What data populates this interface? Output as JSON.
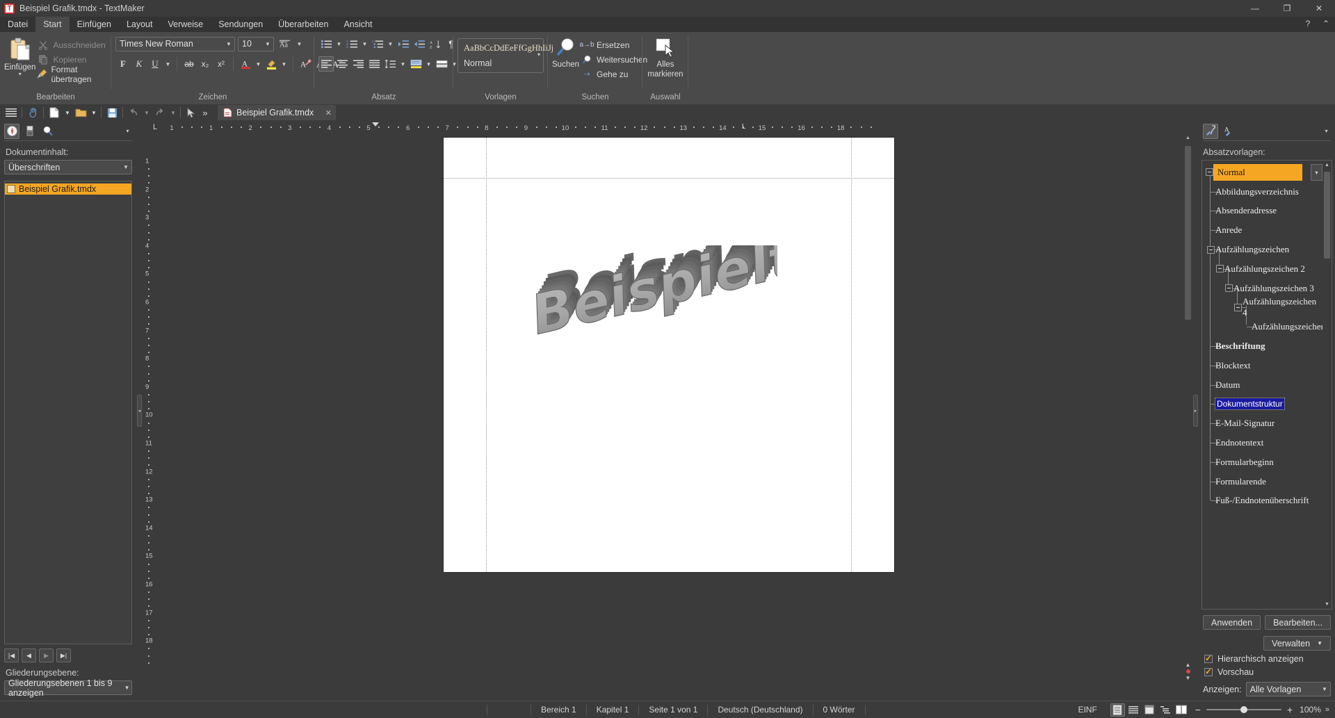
{
  "window": {
    "title": "Beispiel Grafik.tmdx - TextMaker",
    "logo_text": "T",
    "minimize": "—",
    "maximize": "❐",
    "close": "✕",
    "help": "?",
    "ribbon_collapse": "⌃"
  },
  "menu": {
    "items": [
      {
        "label": "Datei",
        "active": false
      },
      {
        "label": "Start",
        "active": true
      },
      {
        "label": "Einfügen",
        "active": false
      },
      {
        "label": "Layout",
        "active": false
      },
      {
        "label": "Verweise",
        "active": false
      },
      {
        "label": "Sendungen",
        "active": false
      },
      {
        "label": "Überarbeiten",
        "active": false
      },
      {
        "label": "Ansicht",
        "active": false
      }
    ]
  },
  "ribbon": {
    "groups": [
      {
        "label": "Bearbeiten"
      },
      {
        "label": "Zeichen"
      },
      {
        "label": "Absatz"
      },
      {
        "label": "Vorlagen"
      },
      {
        "label": "Suchen"
      },
      {
        "label": "Auswahl"
      }
    ],
    "bearbeiten": {
      "paste_label": "Einfügen",
      "paste_caret": "▾",
      "cut_label": "Ausschneiden",
      "copy_label": "Kopieren",
      "format_label": "Format übertragen"
    },
    "zeichen": {
      "font_name": "Times New Roman",
      "font_size": "10",
      "bold": "F",
      "italic": "K",
      "underline": "U",
      "strikethrough": "ab",
      "subscript": "x₂",
      "superscript": "x²",
      "font_color": "A",
      "highlight": "ab",
      "clear_format": "A",
      "grow_font": "A",
      "shrink_font": "A",
      "change_case": "Aa"
    },
    "absatz": {
      "bullets": "bullet-list",
      "numbering": "numbered-list",
      "multilevel": "multilevel-list",
      "increase_indent": "increase-indent",
      "decrease_indent": "decrease-indent",
      "sort": "A↕",
      "show_marks": "¶",
      "align_left": "align-left",
      "align_center": "align-center",
      "align_right": "align-right",
      "justify": "justify",
      "line_spacing": "line-spacing",
      "shading": "shading",
      "borders": "borders"
    },
    "vorlagen": {
      "preview_text": "AaBbCcDdEeFfGgHhIiJj",
      "style_name": "Normal",
      "caret": "▾"
    },
    "suchen": {
      "search_label": "Suchen",
      "replace_label": "Ersetzen",
      "replace_icon": "a→b",
      "find_next_label": "Weitersuchen",
      "goto_label": "Gehe zu",
      "goto_icon": "⇢"
    },
    "auswahl": {
      "select_all_label_line1": "Alles",
      "select_all_label_line2": "markieren"
    }
  },
  "quickbar": {
    "icons": [
      "menu-icon",
      "hand-icon",
      "new-doc-icon",
      "open-folder-icon",
      "save-icon",
      "undo-icon",
      "redo-icon",
      "pointer-icon",
      "more-icon"
    ],
    "more": "»",
    "tab": {
      "title": "Beispiel Grafik.tmdx",
      "close": "✕"
    }
  },
  "left_panel": {
    "toolbar_icons": [
      "navigator-icon",
      "objects-icon",
      "search-icon"
    ],
    "toolbar_caret": "▾",
    "content_label": "Dokumentinhalt:",
    "content_filter": "Überschriften",
    "tree_items": [
      {
        "label": "Beispiel Grafik.tmdx",
        "selected": true
      }
    ],
    "nav_buttons": [
      "|◀",
      "◀",
      "▶",
      "▶|"
    ],
    "outline_label": "Gliederungsebene:",
    "outline_value": "Gliederungsebenen 1 bis 9 anzeigen",
    "combo_caret": "▾"
  },
  "ruler": {
    "h_ticks": [
      "1",
      "1",
      "2",
      "3",
      "4",
      "5",
      "6",
      "7",
      "8",
      "9",
      "10",
      "11",
      "12",
      "13",
      "14",
      "15",
      "16",
      "18"
    ],
    "v_ticks": [
      "1",
      "2",
      "3",
      "4",
      "5",
      "6",
      "7",
      "8",
      "9",
      "10",
      "11",
      "12",
      "13",
      "14",
      "15",
      "16",
      "17",
      "18"
    ],
    "corner_marker": "L",
    "tab_marker": "L"
  },
  "document": {
    "wordart_text": "Beispieltext",
    "page_bg": "#ffffff"
  },
  "right_panel": {
    "toolbar_icons": [
      "paragraph-style-icon",
      "character-style-icon"
    ],
    "toolbar_caret": "▾",
    "styles_label": "Absatzvorlagen:",
    "styles": [
      {
        "label": "Normal",
        "indent": 0,
        "selected": true,
        "expander": true,
        "bold": false
      },
      {
        "label": "Abbildungsverzeichnis",
        "indent": 1,
        "selected": false,
        "expander": false,
        "bold": false
      },
      {
        "label": "Absenderadresse",
        "indent": 1,
        "selected": false,
        "expander": false,
        "bold": false
      },
      {
        "label": "Anrede",
        "indent": 1,
        "selected": false,
        "expander": false,
        "bold": false
      },
      {
        "label": "Aufzählungszeichen",
        "indent": 1,
        "selected": false,
        "expander": true,
        "bold": false
      },
      {
        "label": "Aufzählungszeichen 2",
        "indent": 2,
        "selected": false,
        "expander": true,
        "bold": false
      },
      {
        "label": "Aufzählungszeichen 3",
        "indent": 3,
        "selected": false,
        "expander": true,
        "bold": false
      },
      {
        "label": "Aufzählungszeichen 4",
        "indent": 4,
        "selected": false,
        "expander": true,
        "bold": false
      },
      {
        "label": "Aufzählungszeichen",
        "indent": 5,
        "selected": false,
        "expander": false,
        "bold": false
      },
      {
        "label": "Beschriftung",
        "indent": 1,
        "selected": false,
        "expander": false,
        "bold": true
      },
      {
        "label": "Blocktext",
        "indent": 1,
        "selected": false,
        "expander": false,
        "bold": false
      },
      {
        "label": "Datum",
        "indent": 1,
        "selected": false,
        "expander": false,
        "bold": false
      },
      {
        "label": "Dokumentstruktur",
        "indent": 1,
        "selected": false,
        "expander": false,
        "bold": false,
        "highlight": true
      },
      {
        "label": "E-Mail-Signatur",
        "indent": 1,
        "selected": false,
        "expander": false,
        "bold": false
      },
      {
        "label": "Endnotentext",
        "indent": 1,
        "selected": false,
        "expander": false,
        "bold": false
      },
      {
        "label": "Formularbeginn",
        "indent": 1,
        "selected": false,
        "expander": false,
        "bold": false
      },
      {
        "label": "Formularende",
        "indent": 1,
        "selected": false,
        "expander": false,
        "bold": false
      },
      {
        "label": "Fuß-/Endnotenüberschrift",
        "indent": 1,
        "selected": false,
        "expander": false,
        "bold": false
      }
    ],
    "apply_button": "Anwenden",
    "edit_button": "Bearbeiten...",
    "manage_button": "Verwalten",
    "hierarchical_label": "Hierarchisch anzeigen",
    "hierarchical_checked": true,
    "preview_label": "Vorschau",
    "preview_checked": true,
    "show_label": "Anzeigen:",
    "show_value": "Alle Vorlagen",
    "caret": "▾"
  },
  "statusbar": {
    "section": "Bereich 1",
    "chapter": "Kapitel 1",
    "page": "Seite 1 von 1",
    "language": "Deutsch (Deutschland)",
    "words": "0 Wörter",
    "insert_mode": "EINF",
    "view_modes": [
      "page-view-icon",
      "draft-view-icon",
      "fullscreen-view-icon",
      "outline-view-icon",
      "book-view-icon"
    ],
    "zoom_minus": "−",
    "zoom_plus": "+",
    "zoom_level": "100%",
    "overflow": "»"
  },
  "colors": {
    "accent_orange": "#f5a623",
    "window_bg": "#3b3b3b",
    "ribbon_bg": "#4a4a4a",
    "highlight_blue": "#1a1a9e",
    "logo_red": "#d02a2a"
  }
}
